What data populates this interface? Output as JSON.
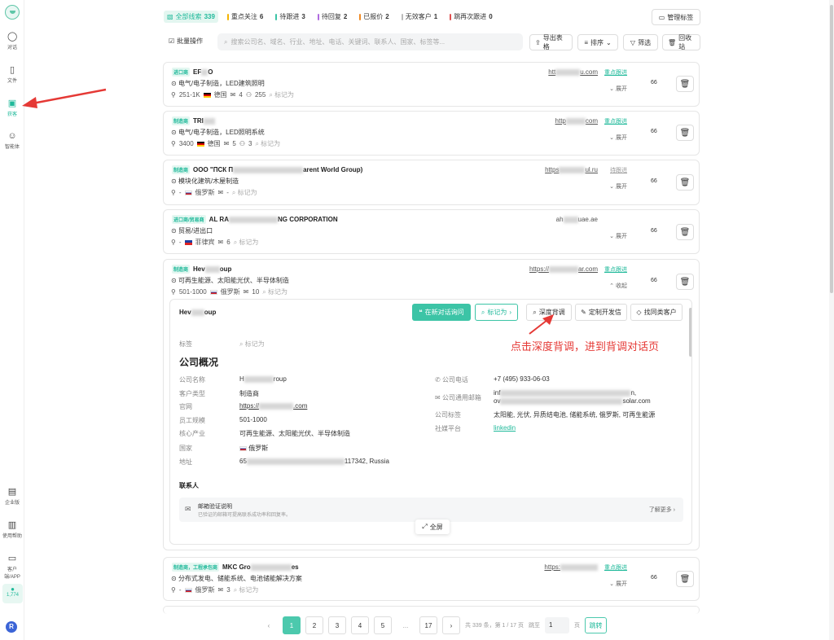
{
  "sidebar": {
    "items": [
      {
        "label": "对话",
        "icon": "chat-icon"
      },
      {
        "label": "文件",
        "icon": "file-icon"
      },
      {
        "label": "获客",
        "icon": "customer-icon"
      },
      {
        "label": "智能体",
        "icon": "agent-icon"
      }
    ],
    "bottom": [
      {
        "label": "企业版",
        "icon": "enterprise-icon"
      },
      {
        "label": "使用帮助",
        "icon": "help-book-icon"
      },
      {
        "label": "客户端/APP",
        "icon": "device-icon"
      }
    ],
    "count": "1,774",
    "avatar": "R"
  },
  "filters": [
    {
      "label": "全部线索",
      "count": "339",
      "color": "#1fb99a"
    },
    {
      "label": "重点关注",
      "count": "6",
      "color": "#f5b400"
    },
    {
      "label": "待跟进",
      "count": "3",
      "color": "#3cc4a6"
    },
    {
      "label": "待回复",
      "count": "2",
      "color": "#b06be0"
    },
    {
      "label": "已报价",
      "count": "2",
      "color": "#f08a24"
    },
    {
      "label": "无效客户",
      "count": "1",
      "color": "#bbbbbb"
    },
    {
      "label": "跳再次跟进",
      "count": "0",
      "color": "#e05050"
    }
  ],
  "toolbar": {
    "manage_tags": "管理标签",
    "batch": "批量操作",
    "search_placeholder": "搜索公司名、域名、行业、地址、电话、关键词、联系人、国家、标签等...",
    "export": "导出表格",
    "sort": "排序",
    "filter": "筛选",
    "recycle": "回收站"
  },
  "cards": [
    {
      "tag": "进口商",
      "name": "EF",
      "name2": "O",
      "industry": "电气/电子制造，LED建筑照明",
      "meta": [
        "251-1K",
        "德国",
        "4",
        "255"
      ],
      "flag": "de",
      "url": "htt",
      "url2": "u.com",
      "status": "重点跟进",
      "expand": "展开",
      "score": "66",
      "mark": "标记为"
    },
    {
      "tag": "制造商",
      "name": "TRI",
      "name2": "",
      "industry": "电气/电子制造，LED照明系统",
      "meta": [
        "3400",
        "德国",
        "5",
        "3"
      ],
      "flag": "de",
      "url": "http",
      "url2": "com",
      "status": "重点跟进",
      "expand": "展开",
      "score": "66",
      "mark": "标记为"
    },
    {
      "tag": "制造商",
      "name": "OOO \"ПСК П",
      "name2": "arent World Group)",
      "industry": "模块化建筑/木屋制造",
      "meta": [
        "-",
        "俄罗斯",
        "-",
        ""
      ],
      "flag": "ru",
      "url": "https",
      "url2": "ul.ru",
      "status": "待跟进",
      "expand": "展开",
      "score": "66",
      "mark": "标记为"
    },
    {
      "tag": "进口商/贸易商",
      "name": "AL RA",
      "name2": "NG CORPORATION",
      "industry": "贸易/进出口",
      "meta": [
        "-",
        "菲律宾",
        "6",
        ""
      ],
      "flag": "ph",
      "url": "ah",
      "url2": "uae.ae",
      "status": "",
      "expand": "展开",
      "score": "66",
      "mark": "标记为"
    },
    {
      "tag": "制造商",
      "name": "Hev",
      "name2": "oup",
      "industry": "可再生能源、太阳能光伏、半导体制造",
      "meta": [
        "501-1000",
        "俄罗斯",
        "10",
        ""
      ],
      "flag": "ru",
      "url": "https://",
      "url2": "ar.com",
      "status": "重点跟进",
      "expand": "收起",
      "score": "66",
      "mark": "标记为"
    },
    {
      "tag": "制造商，工程承包商",
      "name": "MKC Gro",
      "name2": "es",
      "industry": "分布式发电、储能系统、电池储能解决方案",
      "meta": [
        "-",
        "俄罗斯",
        "3",
        ""
      ],
      "flag": "ru",
      "url": "https:",
      "url2": "",
      "status": "重点跟进",
      "expand": "展开",
      "score": "66",
      "mark": "标记为"
    }
  ],
  "detail": {
    "name": "Hev",
    "name2": "oup",
    "chat_btn": "在新对话询问",
    "mark_btn": "标记为",
    "deep_btn": "深度背调",
    "letter_btn": "定制开发信",
    "similar_btn": "找同类客户",
    "tag_label": "标签",
    "tag_mark": "标记为",
    "overview": "公司概况",
    "left": [
      {
        "k": "公司名称",
        "v": "H",
        "v2": "roup"
      },
      {
        "k": "客户类型",
        "v": "制造商",
        "v2": ""
      },
      {
        "k": "官网",
        "v": "https://",
        "v2": ".com"
      },
      {
        "k": "员工规模",
        "v": "501-1000",
        "v2": ""
      },
      {
        "k": "核心产业",
        "v": "可再生能源、太阳能光伏、半导体制造",
        "v2": ""
      },
      {
        "k": "国家",
        "v": "俄罗斯",
        "v2": ""
      },
      {
        "k": "地址",
        "v": "65",
        "v2": "117342, Russia"
      }
    ],
    "right": [
      {
        "k": "公司电话",
        "v": "+7 (495) 933-06-03"
      },
      {
        "k": "公司通用邮箱",
        "v": "inf",
        "v2": "n,",
        "v3": "ov",
        "v4": "solar.com"
      },
      {
        "k": "公司标签",
        "v": "太阳能, 光伏, 异质结电池, 储能系统, 俄罗斯, 可再生能源"
      },
      {
        "k": "社媒平台",
        "v": "linkedin"
      }
    ],
    "contacts": "联系人",
    "notice_title": "邮箱验证说明",
    "notice_sub": "已验证的邮箱可提高联系成功率和回复率。",
    "notice_more": "了解更多",
    "fullscreen": "全屏"
  },
  "annotation": "点击深度背调，进到背调对话页",
  "pager": {
    "pages": [
      "1",
      "2",
      "3",
      "4",
      "5",
      "...",
      "17"
    ],
    "info": "共 339 条，第 1 / 17 页",
    "jump_label": "跳至",
    "jump_value": "1",
    "page_unit": "页",
    "jump_btn": "跳转"
  }
}
